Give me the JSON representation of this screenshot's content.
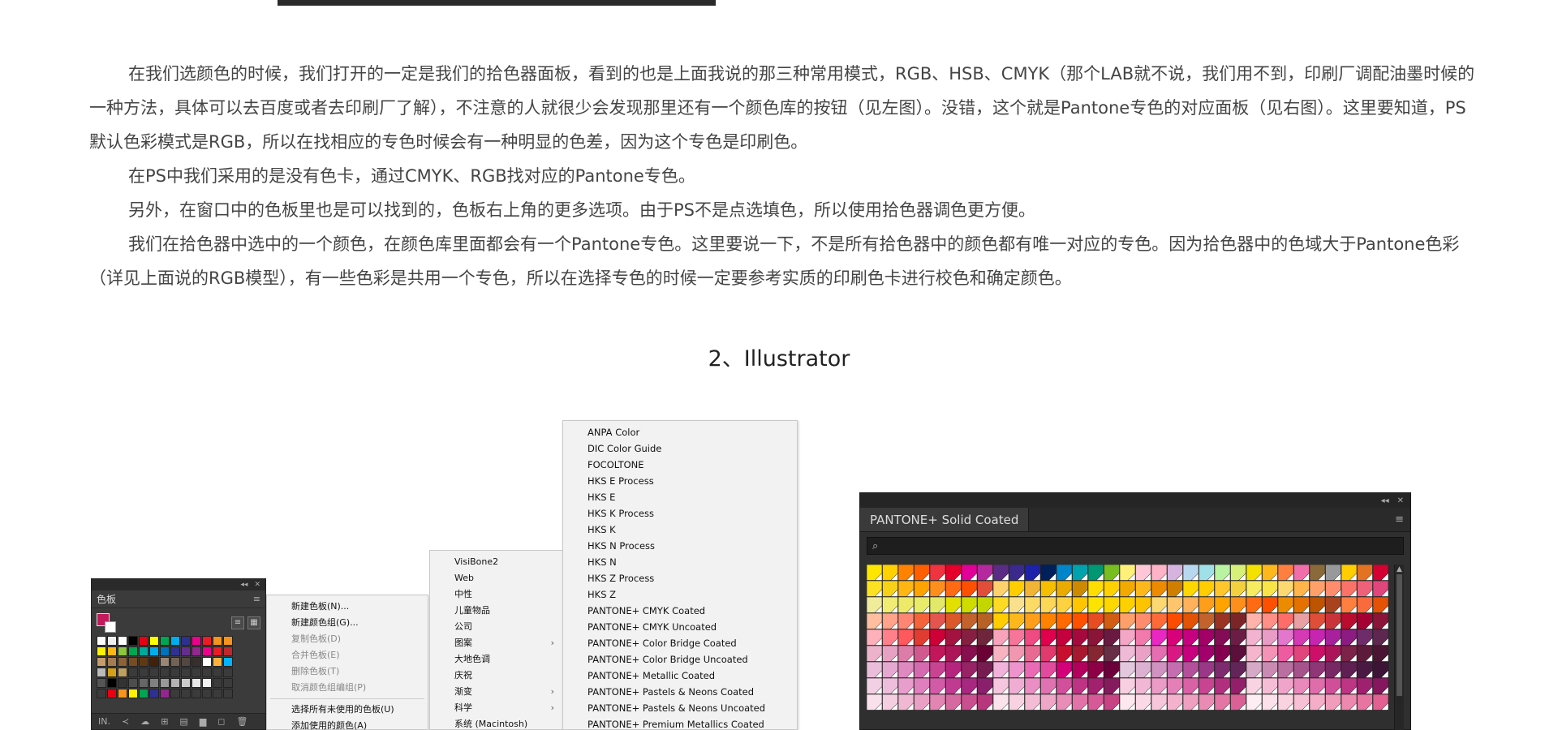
{
  "article": {
    "paragraphs": [
      "在我们选颜色的时候，我们打开的一定是我们的拾色器面板，看到的也是上面我说的那三种常用模式，RGB、HSB、CMYK（那个LAB就不说，我们用不到，印刷厂调配油墨时候的一种方法，具体可以去百度或者去印刷厂了解），不注意的人就很少会发现那里还有一个颜色库的按钮（见左图）。没错，这个就是Pantone专色的对应面板（见右图）。这里要知道，PS默认色彩模式是RGB，所以在找相应的专色时候会有一种明显的色差，因为这个专色是印刷色。",
      "在PS中我们采用的是没有色卡，通过CMYK、RGB找对应的Pantone专色。",
      "另外，在窗口中的色板里也是可以找到的，色板右上角的更多选项。由于PS不是点选填色，所以使用拾色器调色更方便。",
      "我们在拾色器中选中的一个颜色，在颜色库里面都会有一个Pantone专色。这里要说一下，不是所有拾色器中的颜色都有唯一对应的专色。因为拾色器中的色域大于Pantone色彩（详见上面说的RGB模型），有一些色彩是共用一个专色，所以在选择专色的时候一定要参考实质的印刷色卡进行校色和确定颜色。"
    ]
  },
  "section_title": "2、Illustrator",
  "swatches_panel": {
    "collapse": "◂◂",
    "close": "✕",
    "tab": "色板",
    "menu": "≡",
    "fill_color": "#c21a5c",
    "view_list": "≡",
    "view_grid": "▦",
    "rows": [
      [
        "#ffffff",
        "#f0f0f0",
        "#ffffff",
        "#000000",
        "#e60012",
        "#ffff00",
        "#00a651",
        "#00aeef",
        "#2e3192",
        "#ec008c",
        "#ed1c24",
        "#f7941d",
        "#f7941d"
      ],
      [
        "#fff200",
        "#fdb813",
        "#8dc63f",
        "#00a651",
        "#00a99d",
        "#00aeef",
        "#0072bc",
        "#2e3192",
        "#662d91",
        "#92278f",
        "#ec008c",
        "#ed1c24",
        "#c1272d"
      ],
      [
        "#c69c6d",
        "#a67c52",
        "#8c6239",
        "#754c24",
        "#603913",
        "#42210b",
        "#998675",
        "#736357",
        "#534741",
        "#362f2d",
        "#ffffff",
        "#fbb040",
        "#00b4ff"
      ],
      [
        "#bbbbbb",
        "#d4a017",
        "#c0a060",
        "#3b3b3b",
        "#3b3b3b",
        "#3b3b3b",
        "#3b3b3b",
        "#3b3b3b",
        "#3b3b3b",
        "#3b3b3b",
        "#3b3b3b",
        "#3b3b3b",
        "#3b3b3b"
      ],
      [
        "#555555",
        "#000000",
        "#333333",
        "#4d4d4d",
        "#666666",
        "#808080",
        "#999999",
        "#b3b3b3",
        "#cccccc",
        "#e6e6e6",
        "#f2f2f2",
        "#3b3b3b",
        "#3b3b3b"
      ],
      [
        "#3b3b3b",
        "#e60012",
        "#f7941d",
        "#fff200",
        "#00a651",
        "#2e3192",
        "#92278f",
        "#3b3b3b",
        "#3b3b3b",
        "#3b3b3b",
        "#3b3b3b",
        "#3b3b3b",
        "#3b3b3b"
      ]
    ],
    "bottom_icons": [
      "IN.",
      "≺",
      "☁",
      "⊞",
      "▤",
      "▆",
      "◻",
      "🗑"
    ]
  },
  "context_menu": {
    "items": [
      {
        "label": "新建色板(N)...",
        "disabled": false
      },
      {
        "label": "新建颜色组(G)...",
        "disabled": false
      },
      {
        "label": "复制色板(D)",
        "disabled": true
      },
      {
        "label": "合并色板(E)",
        "disabled": true
      },
      {
        "label": "删除色板(T)",
        "disabled": true
      },
      {
        "label": "取消颜色组编组(P)",
        "disabled": true
      },
      {
        "label": "选择所有未使用的色板(U)",
        "disabled": false
      },
      {
        "label": "添加使用的颜色(A)",
        "disabled": false
      }
    ]
  },
  "library_menu": {
    "items": [
      {
        "label": "VisiBone2",
        "arrow": ""
      },
      {
        "label": "Web",
        "arrow": ""
      },
      {
        "label": "中性",
        "arrow": ""
      },
      {
        "label": "儿童物品",
        "arrow": ""
      },
      {
        "label": "公司",
        "arrow": ""
      },
      {
        "label": "图案",
        "arrow": "›"
      },
      {
        "label": "大地色调",
        "arrow": ""
      },
      {
        "label": "庆祝",
        "arrow": ""
      },
      {
        "label": "渐变",
        "arrow": "›"
      },
      {
        "label": "科学",
        "arrow": "›"
      },
      {
        "label": "系统 (Macintosh)",
        "arrow": ""
      }
    ]
  },
  "color_book_menu": {
    "items": [
      "ANPA Color",
      "DIC Color Guide",
      "FOCOLTONE",
      "HKS E Process",
      "HKS E",
      "HKS K Process",
      "HKS K",
      "HKS N Process",
      "HKS N",
      "HKS Z Process",
      "HKS Z",
      "PANTONE+ CMYK Coated",
      "PANTONE+ CMYK Uncoated",
      "PANTONE+ Color Bridge Coated",
      "PANTONE+ Color Bridge Uncoated",
      "PANTONE+ Metallic Coated",
      "PANTONE+ Pastels & Neons Coated",
      "PANTONE+ Pastels & Neons Uncoated",
      "PANTONE+ Premium Metallics Coated"
    ]
  },
  "pantone_panel": {
    "collapse": "◂◂",
    "close": "✕",
    "tab": "PANTONE+ Solid Coated",
    "menu": "≡",
    "search_icon": "⌕",
    "search_value": "",
    "scroll_up": "▲",
    "swatch_rows": [
      [
        "#ffe600",
        "#ffd100",
        "#ff8200",
        "#ff5f00",
        "#ef3340",
        "#e4002b",
        "#e10098",
        "#b5289e",
        "#5b2c86",
        "#3a2a8c",
        "#1e22aa",
        "#00205b",
        "#0085ca",
        "#00a3ad",
        "#009775",
        "#78be20",
        "#fff07a",
        "#ffc6d8",
        "#ffb3c8",
        "#d7b3e0",
        "#b8d8f0",
        "#a0e0e8",
        "#b9f2a0",
        "#d6f07a",
        "#f5e100",
        "#ffb81c",
        "#ff7f41",
        "#f06ea9",
        "#8a6a3a",
        "#97999b",
        "#ffcd00",
        "#e37222",
        "#d50032"
      ],
      [
        "#fbe122",
        "#f7d117",
        "#ffb612",
        "#ffa300",
        "#ff8f1c",
        "#ff6a13",
        "#fe5000",
        "#e04e39",
        "#fdd26e",
        "#ffcd00",
        "#f1b434",
        "#f6be00",
        "#eaaa00",
        "#cc8a00",
        "#fedd00",
        "#ffd100",
        "#f2a900",
        "#ffb81c",
        "#ed8b00",
        "#cf7f00",
        "#ffd700",
        "#ffcd00",
        "#ffc72c",
        "#f3d03e",
        "#f6eb61",
        "#f9e547",
        "#fbd872",
        "#ffb549",
        "#ffa06a",
        "#ff8d6d",
        "#fa7268",
        "#ef6079",
        "#e0457b"
      ],
      [
        "#f1eb9c",
        "#f0ec74",
        "#edea69",
        "#e9ec6b",
        "#e2e868",
        "#e1e000",
        "#cedc00",
        "#c4d600",
        "#fdda24",
        "#f8e08e",
        "#fbdb65",
        "#fdd757",
        "#fed141",
        "#ffc600",
        "#fce300",
        "#fdd800",
        "#fdd000",
        "#fcc300",
        "#fbd872",
        "#ffc56e",
        "#ffb25b",
        "#ff9e1b",
        "#ffa300",
        "#ff8f1c",
        "#ff6a13",
        "#fe5000",
        "#ed8b00",
        "#e57200",
        "#be5400",
        "#a9431e",
        "#ff7f41",
        "#f96a3c",
        "#e35205"
      ],
      [
        "#ffbe9f",
        "#ffa38b",
        "#ff8674",
        "#f4633a",
        "#e5554f",
        "#dc582a",
        "#c4622d",
        "#b86125",
        "#ffcd00",
        "#ffb81c",
        "#ff9e1b",
        "#ff8200",
        "#ff6900",
        "#ff5000",
        "#e84c22",
        "#d25d12",
        "#ffa06a",
        "#ff8d6d",
        "#ff6a39",
        "#fc4c02",
        "#e35205",
        "#c4622d",
        "#9a3324",
        "#7c2529",
        "#ffb3ab",
        "#ff8f87",
        "#ff6d6a",
        "#e8a0a4",
        "#e04e39",
        "#cb333b",
        "#ba0c2f",
        "#a50034",
        "#8a1538"
      ],
      [
        "#ffb1bb",
        "#ff808b",
        "#ff585d",
        "#e03c31",
        "#ce0037",
        "#a4123f",
        "#861f41",
        "#6f263d",
        "#f8a3bc",
        "#f67599",
        "#ef4a81",
        "#e0004d",
        "#c5003e",
        "#a6093d",
        "#8a1538",
        "#6a1a41",
        "#f4a6c6",
        "#f179ab",
        "#ea27c2",
        "#d9017a",
        "#c6007e",
        "#a20067",
        "#840b55",
        "#6c1d45",
        "#f2b3d1",
        "#e89cc6",
        "#e277cd",
        "#d539b5",
        "#c724b1",
        "#a8209b",
        "#8c1b82",
        "#6e2c6b",
        "#5e2750"
      ],
      [
        "#ecb3cb",
        "#e7a2c3",
        "#de7ca9",
        "#d05a8f",
        "#c2185b",
        "#ad1457",
        "#880e4f",
        "#6a0033",
        "#f7b3c2",
        "#f197b0",
        "#e86a92",
        "#e03a6e",
        "#c8102e",
        "#a6192e",
        "#862633",
        "#672e45",
        "#efbad6",
        "#e9a2c6",
        "#e56db1",
        "#da1884",
        "#c6007e",
        "#a2006d",
        "#84004f",
        "#5c0f3b",
        "#f5b6cd",
        "#f493b5",
        "#ef5ba1",
        "#e0457b",
        "#ce0f69",
        "#ac145a",
        "#7d2248",
        "#5e1a3a",
        "#4a1532"
      ],
      [
        "#eabedb",
        "#e5a8d0",
        "#e089c1",
        "#d66ab0",
        "#c94393",
        "#b5257e",
        "#972266",
        "#761c51",
        "#f1b2dc",
        "#ee93cb",
        "#ea6ab5",
        "#e24a9d",
        "#d4007a",
        "#b3005c",
        "#8e0046",
        "#6b003a",
        "#e3c8dd",
        "#dcb0d0",
        "#d092c0",
        "#c46daf",
        "#b4509b",
        "#9b3787",
        "#7e2a6e",
        "#632459",
        "#d6a9c6",
        "#c98bb3",
        "#b96f9f",
        "#a6538b",
        "#8f3677",
        "#792866",
        "#5f1f52",
        "#4a1943",
        "#3c1436"
      ],
      [
        "#f3cfe3",
        "#eebddb",
        "#e89dcc",
        "#e07fbd",
        "#d35aa6",
        "#c13a92",
        "#a82881",
        "#8a1f6b",
        "#f5c6de",
        "#f0add3",
        "#ea8ec3",
        "#e172b2",
        "#d24f9c",
        "#bf3385",
        "#a1216f",
        "#851a5d",
        "#f7cfe0",
        "#f2b7d5",
        "#ec9bc7",
        "#e47fb8",
        "#d961a6",
        "#c84493",
        "#b22f80",
        "#931e69",
        "#fad3e3",
        "#f6bdd6",
        "#f0a4c9",
        "#e989bb",
        "#df6cab",
        "#d14e98",
        "#bd3584",
        "#a02070",
        "#86175f"
      ],
      [
        "#f9e0ea",
        "#f5cedf",
        "#f0b8d2",
        "#eaa0c4",
        "#e285b3",
        "#d769a1",
        "#ca4f8f",
        "#b6377b",
        "#fbe3ec",
        "#f8d2e1",
        "#f4bdd5",
        "#efa6c7",
        "#e98cb8",
        "#e173a8",
        "#d65a97",
        "#c64384",
        "#fde8ef",
        "#fbd9e6",
        "#f8c6da",
        "#f4b2cd",
        "#efa0c1",
        "#ea8bb4",
        "#e376a5",
        "#da6096",
        "#fdeef3",
        "#fce1eb",
        "#fad2e0",
        "#f8c0d4",
        "#f5aec8",
        "#f19cbb",
        "#ed88ae",
        "#e874a1",
        "#e26092"
      ]
    ]
  }
}
